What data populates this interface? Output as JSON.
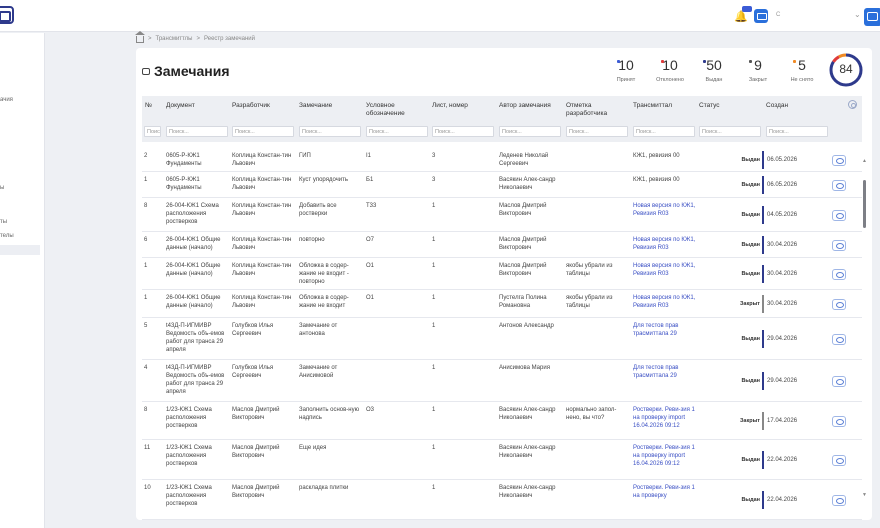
{
  "header": {
    "user_name": "С",
    "caret": "⌄"
  },
  "sidebar": {
    "items": [
      {
        "label": "ачия"
      },
      {
        "label": "ы"
      },
      {
        "label": "ты"
      },
      {
        "label": "телы"
      },
      {
        "label": ""
      }
    ]
  },
  "breadcrumb": {
    "items": [
      "Трансмиттлы",
      "Реестр замечаний"
    ],
    "separator": ">"
  },
  "page": {
    "title": "Замечания"
  },
  "stats": [
    {
      "value": "10",
      "label": "Принят",
      "color": "#3b5bd6"
    },
    {
      "value": "10",
      "label": "Отклонено",
      "color": "#e03a3a"
    },
    {
      "value": "50",
      "label": "Выдан",
      "color": "#2e3a8c"
    },
    {
      "value": "9",
      "label": "Закрыт",
      "color": "#555555"
    },
    {
      "value": "5",
      "label": "Не снято",
      "color": "#f08a24"
    }
  ],
  "gauge": {
    "value": "84",
    "fraction": 0.84,
    "color_main": "#2e3a8c",
    "color_red": "#e03a3a",
    "color_orange": "#f08a24"
  },
  "table": {
    "columns": [
      "№",
      "Документ",
      "Разработчик",
      "Замечание",
      "Условное обозначение",
      "Лист, номер",
      "Автор замечания",
      "Отметка разработчика",
      "Трансмиттал",
      "Статус",
      "Создан"
    ],
    "filters": [
      "Поиск",
      "Поиск...",
      "Поиск...",
      "Поиск...",
      "Поиск...",
      "Поиск...",
      "Поиск...",
      "Поиск...",
      "Поиск...",
      "Поиск...",
      "Поиск..."
    ],
    "rows": [
      {
        "no": "2",
        "doc": "0605-Р-КЖ1 Фундаменты",
        "dev": "Коплица Констан-тин Львович",
        "remark": "ГИП",
        "code": "I1",
        "sheet": "3",
        "author": "Леденев Николай Сергеевич",
        "mark": "",
        "trans": "КЖ1, ревизия 00",
        "trans_link": false,
        "status": "Выдан",
        "status_color": "#2e3a8c",
        "date": "06.05.2026"
      },
      {
        "no": "1",
        "doc": "0605-Р-КЖ1 Фундаменты",
        "dev": "Коплица Констан-тин Львович",
        "remark": "Куст упорядочить",
        "code": "Б1",
        "sheet": "3",
        "author": "Васякин Алек-сандр Николаевич",
        "mark": "",
        "trans": "КЖ1, ревизия 00",
        "trans_link": false,
        "status": "Выдан",
        "status_color": "#2e3a8c",
        "date": "06.05.2026"
      },
      {
        "no": "8",
        "doc": "26-004-КЖ1 Схема расположения ростверков",
        "dev": "Коплица Констан-тин Львович",
        "remark": "Добавить все ростверки",
        "code": "Т33",
        "sheet": "1",
        "author": "Маслов Дмитрий Викторович",
        "mark": "",
        "trans": "Новая версия по КЖ1, Ревизия R03",
        "trans_link": true,
        "status": "Выдан",
        "status_color": "#2e3a8c",
        "date": "04.05.2026"
      },
      {
        "no": "6",
        "doc": "26-004-КЖ1 Общие данные (начало)",
        "dev": "Коплица Констан-тин Львович",
        "remark": "повторно",
        "code": "О7",
        "sheet": "1",
        "author": "Маслов Дмитрий Викторович",
        "mark": "",
        "trans": "Новая версия по КЖ1, Ревизия R03",
        "trans_link": true,
        "status": "Выдан",
        "status_color": "#2e3a8c",
        "date": "30.04.2026"
      },
      {
        "no": "1",
        "doc": "26-004-КЖ1 Общие данные (начало)",
        "dev": "Коплица Констан-тин Львович",
        "remark": "Обложка в содер-жание не входит - повторно",
        "code": "О1",
        "sheet": "1",
        "author": "Маслов Дмитрий Викторович",
        "mark": "якобы убрали из таблицы",
        "trans": "Новая версия по КЖ1, Ревизия R03",
        "trans_link": true,
        "status": "Выдан",
        "status_color": "#2e3a8c",
        "date": "30.04.2026"
      },
      {
        "no": "1",
        "doc": "26-004-КЖ1 Общие данные (начало)",
        "dev": "Коплица Констан-тин Львович",
        "remark": "Обложка в содер-жание не входит",
        "code": "О1",
        "sheet": "1",
        "author": "Пустелга Полина Романовна",
        "mark": "якобы убрали из таблицы",
        "trans": "Новая версия по КЖ1, Ревизия R03",
        "trans_link": true,
        "status": "Закрыт",
        "status_color": "#888888",
        "date": "30.04.2026"
      },
      {
        "no": "5",
        "doc": "t43Д-П-ИГМИВР Ведомость объ-емов работ для транса 29 апреля",
        "dev": "Голубков Илья Сергеевич",
        "remark": "Замечание от антонова",
        "code": "",
        "sheet": "1",
        "author": "Антонов Александр",
        "mark": "",
        "trans": "Для тестов прав трасмиттала 29",
        "trans_link": true,
        "status": "Выдан",
        "status_color": "#2e3a8c",
        "date": "29.04.2026"
      },
      {
        "no": "4",
        "doc": "t43Д-П-ИГМИВР Ведомость объ-емов работ для транса 29 апреля",
        "dev": "Голубков Илья Сергеевич",
        "remark": "Замечание от Анисимовой",
        "code": "",
        "sheet": "1",
        "author": "Анисимова Мария",
        "mark": "",
        "trans": "Для тестов прав трасмиттала 29",
        "trans_link": true,
        "status": "Выдан",
        "status_color": "#2e3a8c",
        "date": "29.04.2026"
      },
      {
        "no": "8",
        "doc": "1/23-КЖ1 Схема расположения ростверков",
        "dev": "Маслов Дмитрий Викторович",
        "remark": "Заполнить основ-ную надпись",
        "code": "О3",
        "sheet": "1",
        "author": "Васякин Алек-сандр Николаевич",
        "mark": "нормально запол-нено, вы что?",
        "trans": "Ростверки. Реви-зия 1 на проверку import 16.04.2026 09:12",
        "trans_link": true,
        "status": "Закрыт",
        "status_color": "#888888",
        "date": "17.04.2026"
      },
      {
        "no": "11",
        "doc": "1/23-КЖ1 Схема расположения ростверков",
        "dev": "Маслов Дмитрий Викторович",
        "remark": "Еще идея",
        "code": "",
        "sheet": "1",
        "author": "Васякин Алек-сандр Николаевич",
        "mark": "",
        "trans": "Ростверки. Реви-зия 1 на проверку import 16.04.2026 09:12",
        "trans_link": true,
        "status": "Выдан",
        "status_color": "#2e3a8c",
        "date": "22.04.2026"
      },
      {
        "no": "10",
        "doc": "1/23-КЖ1 Схема расположения ростверков",
        "dev": "Маслов Дмитрий Викторович",
        "remark": "раскладка плитки",
        "code": "",
        "sheet": "1",
        "author": "Васякин Алек-сандр Николаевич",
        "mark": "",
        "trans": "Ростверки. Реви-зия 1 на проверку",
        "trans_link": true,
        "status": "Выдан",
        "status_color": "#2e3a8c",
        "date": "22.04.2026"
      }
    ]
  }
}
